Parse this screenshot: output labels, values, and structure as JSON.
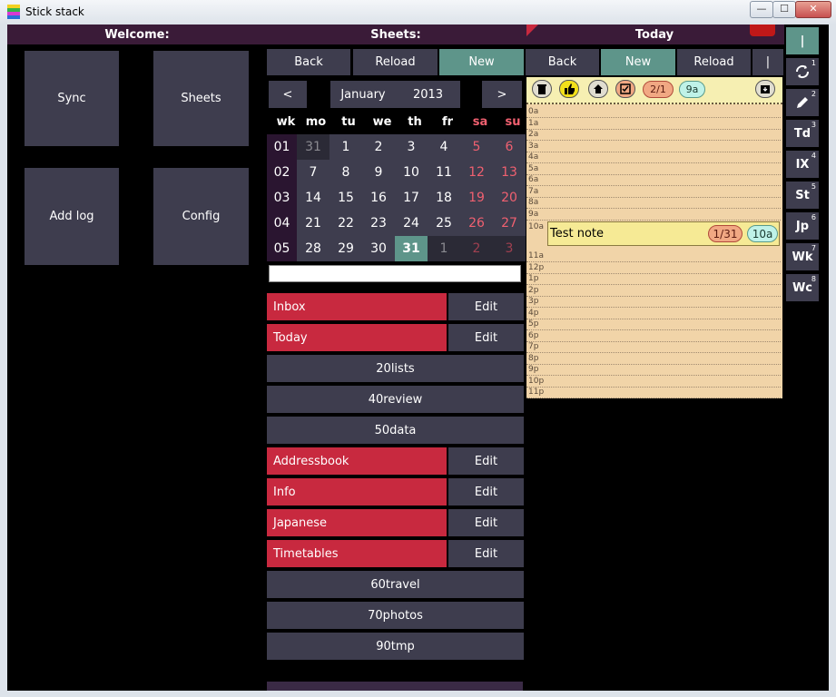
{
  "window": {
    "title": "Stick stack",
    "min": "—",
    "max": "☐",
    "close": "✕"
  },
  "welcome": {
    "header": "Welcome:",
    "tiles": [
      "Sync",
      "Sheets",
      "Add log",
      "Config"
    ]
  },
  "sheets": {
    "header": "Sheets:",
    "toolbar": {
      "back": "Back",
      "reload": "Reload",
      "new": "New"
    },
    "calendar": {
      "prev": "<",
      "month": "January",
      "year": "2013",
      "next": ">",
      "dows": [
        "wk",
        "mo",
        "tu",
        "we",
        "th",
        "fr",
        "sa",
        "su"
      ],
      "weeks": [
        {
          "wk": "01",
          "days": [
            "31",
            "1",
            "2",
            "3",
            "4",
            "5",
            "6"
          ]
        },
        {
          "wk": "02",
          "days": [
            "7",
            "8",
            "9",
            "10",
            "11",
            "12",
            "13"
          ]
        },
        {
          "wk": "03",
          "days": [
            "14",
            "15",
            "16",
            "17",
            "18",
            "19",
            "20"
          ]
        },
        {
          "wk": "04",
          "days": [
            "21",
            "22",
            "23",
            "24",
            "25",
            "26",
            "27"
          ]
        },
        {
          "wk": "05",
          "days": [
            "28",
            "29",
            "30",
            "31",
            "1",
            "2",
            "3"
          ]
        }
      ]
    },
    "search_value": "",
    "list": [
      {
        "label": "Inbox",
        "edit": "Edit"
      },
      {
        "label": "Today",
        "edit": "Edit"
      },
      {
        "label": "20lists"
      },
      {
        "label": "40review"
      },
      {
        "label": "50data"
      },
      {
        "label": "Addressbook",
        "edit": "Edit"
      },
      {
        "label": "Info",
        "edit": "Edit"
      },
      {
        "label": "Japanese",
        "edit": "Edit"
      },
      {
        "label": "Timetables",
        "edit": "Edit"
      },
      {
        "label": "60travel"
      },
      {
        "label": "70photos"
      },
      {
        "label": "90tmp"
      }
    ]
  },
  "today": {
    "header": "Today",
    "toolbar": {
      "back": "Back",
      "new": "New",
      "reload": "Reload",
      "pipe": "|"
    },
    "pills": {
      "date": "2/1",
      "time": "9a"
    },
    "hours_before": [
      "0a",
      "1a",
      "2a",
      "3a",
      "4a",
      "5a",
      "6a",
      "7a",
      "8a",
      "9a"
    ],
    "note": {
      "hour": "10a",
      "text": "Test note",
      "date": "1/31",
      "time": "10a"
    },
    "hours_after": [
      "11a",
      "12p",
      "1p",
      "2p",
      "3p",
      "4p",
      "5p",
      "6p",
      "7p",
      "8p",
      "9p",
      "10p",
      "11p"
    ]
  },
  "sidebar": [
    {
      "label": "|",
      "num": ""
    },
    {
      "label": "",
      "num": "1"
    },
    {
      "label": "",
      "num": "2"
    },
    {
      "label": "Td",
      "num": "3"
    },
    {
      "label": "IX",
      "num": "4"
    },
    {
      "label": "St",
      "num": "5"
    },
    {
      "label": "Jp",
      "num": "6"
    },
    {
      "label": "Wk",
      "num": "7"
    },
    {
      "label": "Wc",
      "num": "8"
    }
  ],
  "colors": {
    "header_bg": "#3a1b38",
    "button": "#3e3d4e",
    "accent_green": "#5e958a",
    "accent_red": "#c8293f",
    "note_bg": "#f1d4a8"
  }
}
